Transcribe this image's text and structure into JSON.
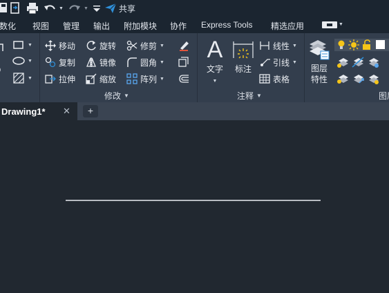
{
  "quick_access": {
    "share_label": "共享"
  },
  "ribbon_tabs": [
    {
      "label": "参数化"
    },
    {
      "label": "视图"
    },
    {
      "label": "管理"
    },
    {
      "label": "输出"
    },
    {
      "label": "附加模块"
    },
    {
      "label": "协作"
    },
    {
      "label": "Express Tools"
    },
    {
      "label": "精选应用"
    }
  ],
  "modify_panel": {
    "title": "修改",
    "commands": [
      {
        "label": "移动",
        "icon": "move-icon"
      },
      {
        "label": "旋转",
        "icon": "rotate-icon"
      },
      {
        "label": "修剪",
        "icon": "trim-icon"
      },
      {
        "label": "复制",
        "icon": "copy-icon"
      },
      {
        "label": "镜像",
        "icon": "mirror-icon"
      },
      {
        "label": "圆角",
        "icon": "fillet-icon"
      },
      {
        "label": "拉伸",
        "icon": "stretch-icon"
      },
      {
        "label": "缩放",
        "icon": "scale-icon"
      },
      {
        "label": "阵列",
        "icon": "array-icon"
      }
    ]
  },
  "annotation_panel": {
    "title": "注释",
    "text_label": "文字",
    "dimension_label": "标注",
    "linear_label": "线性",
    "leader_label": "引线",
    "table_label": "表格"
  },
  "layers_panel": {
    "title": "图层",
    "layer_properties_label": "图层\n特性"
  },
  "document": {
    "tab_title": "Drawing1*",
    "close_symbol": "✕",
    "new_tab_symbol": "+"
  },
  "colors": {
    "accent": "#2f8fd8",
    "ribbon_bg": "#333e4d",
    "canvas_bg": "#212830",
    "bulb": "#f5c518"
  }
}
